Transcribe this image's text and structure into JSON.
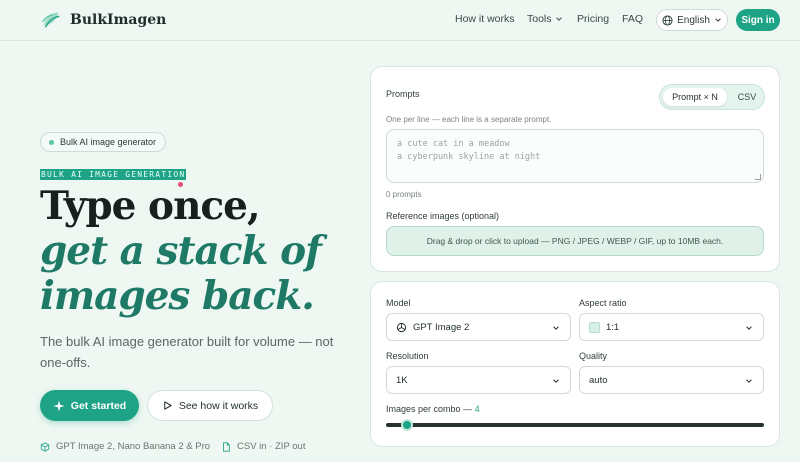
{
  "header": {
    "brand": "BulkImagen",
    "nav": [
      {
        "label": "How it works"
      },
      {
        "label": "Tools",
        "has_dropdown": true
      },
      {
        "label": "Pricing"
      },
      {
        "label": "FAQ"
      }
    ],
    "language": "English",
    "signin": "Sign in"
  },
  "hero": {
    "badge": "Bulk AI image generator",
    "eyebrow": "BULK AI IMAGE GENERATION",
    "headline_line1": "Type once,",
    "headline_line2": "get a stack of",
    "headline_line3": "images back.",
    "subtitle": "The bulk AI image generator built for volume — not one-offs.",
    "primary_cta": "Get started",
    "secondary_cta": "See how it works",
    "features": [
      "GPT Image 2, Nano Banana 2 & Pro",
      "CSV in · ZIP out"
    ]
  },
  "prompts_card": {
    "title": "Prompts",
    "modes": [
      "Prompt × N",
      "CSV"
    ],
    "active_mode": "Prompt × N",
    "hint": "One per line — each line is a separate prompt.",
    "placeholder_line1": "a cute cat in a meadow",
    "placeholder_line2": "a cyberpunk skyline at night",
    "count": "0 prompts",
    "ref_label": "Reference images (optional)",
    "dropzone": "Drag & drop or click to upload — PNG / JPEG / WEBP / GIF, up to 10MB each."
  },
  "settings_card": {
    "model_label": "Model",
    "model_value": "GPT Image 2",
    "aspect_label": "Aspect ratio",
    "aspect_value": "1:1",
    "resolution_label": "Resolution",
    "resolution_value": "1K",
    "quality_label": "Quality",
    "quality_value": "auto",
    "images_label": "Images per combo —",
    "images_value": "4",
    "images_fraction": 0.04
  },
  "colors": {
    "accent": "#1fa386",
    "accent_dark": "#1e7a66",
    "background": "#eef7f2"
  }
}
